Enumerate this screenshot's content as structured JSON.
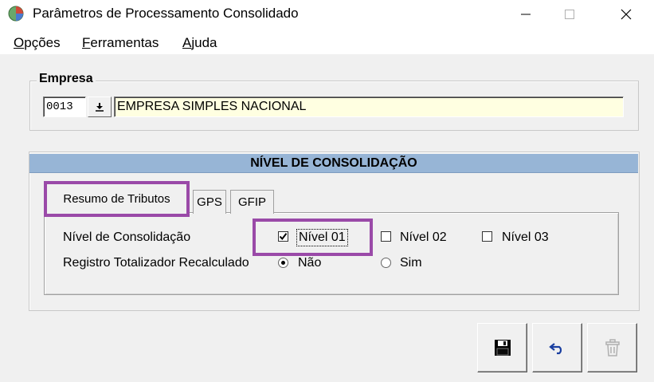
{
  "window": {
    "title": "Parâmetros de Processamento Consolidado"
  },
  "menu": {
    "items": [
      "Opções",
      "Ferramentas",
      "Ajuda"
    ]
  },
  "empresa": {
    "group_label": "Empresa",
    "code": "0013",
    "name": "EMPRESA SIMPLES NACIONAL"
  },
  "nivel": {
    "header": "NÍVEL DE CONSOLIDAÇÃO",
    "tabs": [
      "Resumo de Tributos",
      "GPS",
      "GFIP"
    ],
    "active_tab": "Resumo de Tributos",
    "consolidacao_label": "Nível de Consolidação",
    "checkboxes": [
      {
        "label": "Nível 01",
        "checked": true
      },
      {
        "label": "Nível 02",
        "checked": false
      },
      {
        "label": "Nível 03",
        "checked": false
      }
    ],
    "registro_label": "Registro Totalizador Recalculado",
    "radios": [
      {
        "label": "Não",
        "selected": true
      },
      {
        "label": "Sim",
        "selected": false
      }
    ]
  },
  "toolbar": {
    "icons": [
      "save-icon",
      "undo-icon",
      "delete-icon"
    ],
    "delete_enabled": false
  },
  "colors": {
    "header_bg": "#97b5d6",
    "name_field_bg": "#ffffe1",
    "highlight": "#9a4aa8"
  }
}
